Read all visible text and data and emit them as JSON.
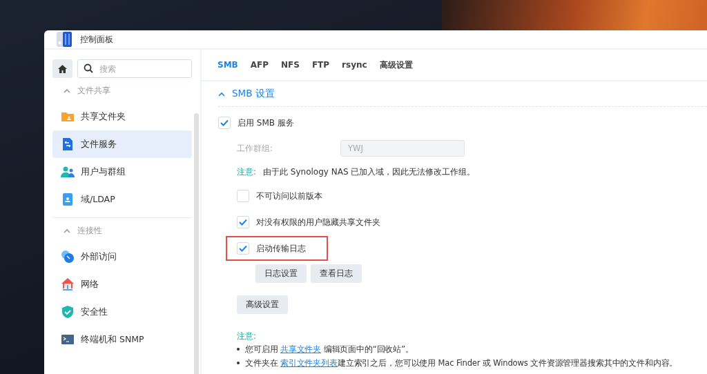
{
  "window": {
    "title": "控制面板"
  },
  "sidebar": {
    "search": {
      "placeholder": "搜索"
    },
    "groups": [
      {
        "title": "文件共享",
        "expanded": true,
        "items": [
          {
            "label": "共享文件夹",
            "selected": false
          },
          {
            "label": "文件服务",
            "selected": true
          },
          {
            "label": "用户与群组",
            "selected": false
          },
          {
            "label": "域/LDAP",
            "selected": false
          }
        ]
      },
      {
        "title": "连接性",
        "expanded": true,
        "items": [
          {
            "label": "外部访问",
            "selected": false
          },
          {
            "label": "网络",
            "selected": false
          },
          {
            "label": "安全性",
            "selected": false
          },
          {
            "label": "终端机和 SNMP",
            "selected": false
          }
        ]
      }
    ]
  },
  "tabs": [
    {
      "label": "SMB",
      "selected": true
    },
    {
      "label": "AFP",
      "selected": false
    },
    {
      "label": "NFS",
      "selected": false
    },
    {
      "label": "FTP",
      "selected": false
    },
    {
      "label": "rsync",
      "selected": false
    },
    {
      "label": "高级设置",
      "selected": false
    }
  ],
  "section": {
    "title": "SMB 设置",
    "expanded": true,
    "items": [
      {
        "kind": "checkbox",
        "label": "启用 SMB 服务",
        "checked": true,
        "children": [
          {
            "kind": "field",
            "label": "工作群组:",
            "value": "YWJ",
            "disabled": true
          },
          {
            "kind": "note",
            "label": "注意:",
            "text": "由于此 Synology NAS 已加入域，因此无法修改工作组。"
          },
          {
            "kind": "checkbox",
            "label": "不可访问以前版本",
            "checked": false
          },
          {
            "kind": "checkbox",
            "label": "对没有权限的用户隐藏共享文件夹",
            "checked": true
          },
          {
            "kind": "checkbox",
            "label": "启动传输日志",
            "checked": true,
            "highlighted": true,
            "children": [
              {
                "kind": "buttons",
                "buttons": [
                  "日志设置",
                  "查看日志"
                ]
              }
            ]
          },
          {
            "kind": "buttons",
            "buttons": [
              "高级设置"
            ]
          },
          {
            "kind": "notes",
            "label": "注意:",
            "bullets": [
              {
                "before": "您可启用 ",
                "link": "共享文件夹",
                "after": " 编辑页面中的“回收站”。"
              },
              {
                "before": "文件夹在 ",
                "link": "索引文件夹列表",
                "after": "建立索引之后，您可以使用 Mac Finder 或 Windows 文件资源管理器搜索其中的文件和内容。"
              }
            ]
          }
        ]
      }
    ]
  }
}
